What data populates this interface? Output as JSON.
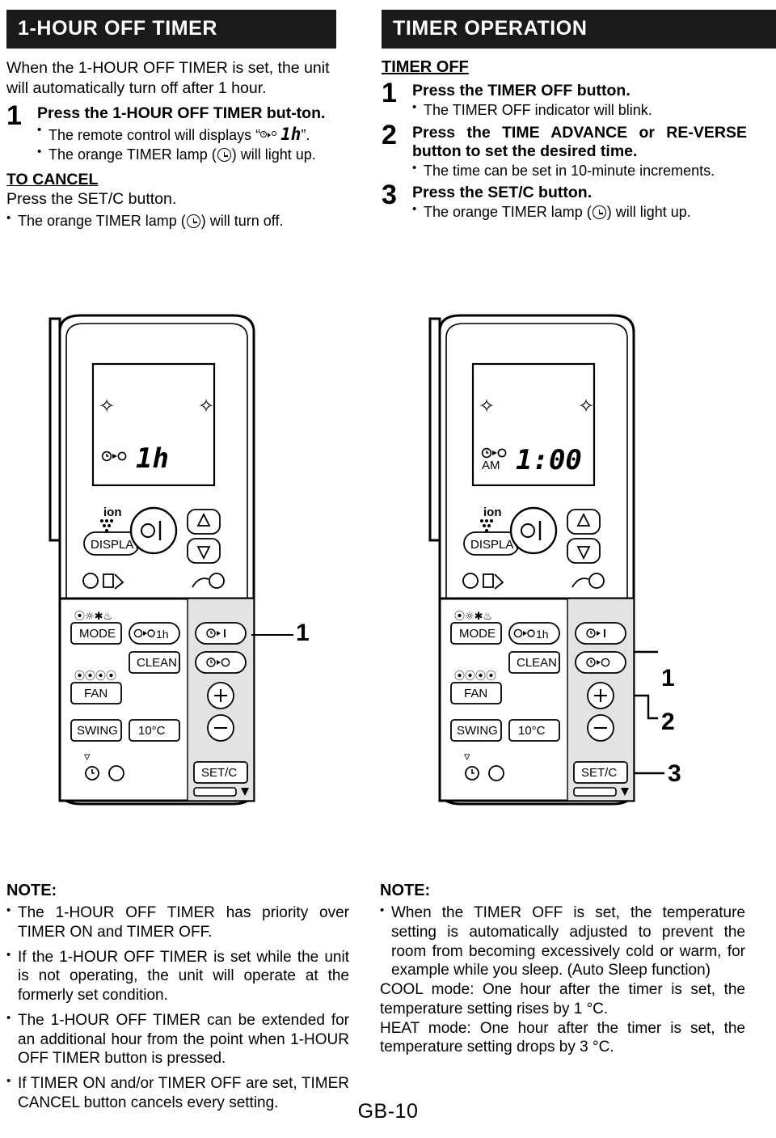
{
  "left": {
    "header": "1-HOUR OFF TIMER",
    "intro": "When the 1-HOUR OFF TIMER is set, the unit will automatically turn off after 1 hour.",
    "step1": {
      "num": "1",
      "title": "Press the 1-HOUR OFF TIMER but-ton.",
      "bullet1_pre": "The remote control will displays “",
      "bullet1_post": "”.",
      "bullet2_pre": "The orange TIMER lamp (",
      "bullet2_post": ") will light up."
    },
    "cancel_title": "TO CANCEL",
    "cancel_line": "Press the SET/C button.",
    "cancel_bullet_pre": "The orange TIMER lamp (",
    "cancel_bullet_post": ") will turn off.",
    "callout": "1",
    "notes": {
      "title": "NOTE:",
      "items": [
        "The 1-HOUR OFF TIMER has priority over TIMER ON and TIMER OFF.",
        "If the 1-HOUR OFF TIMER is set while the unit is not operating, the unit will operate at the formerly set condition.",
        "The 1-HOUR OFF TIMER can be extended for an additional hour from the point when 1-HOUR OFF TIMER button is pressed.",
        "If TIMER ON and/or TIMER OFF are set, TIMER CANCEL button cancels every setting."
      ]
    }
  },
  "right": {
    "header": "TIMER OPERATION",
    "subhead": "TIMER OFF",
    "step1": {
      "num": "1",
      "title": "Press the TIMER OFF button.",
      "bullet": "The TIMER OFF indicator will blink."
    },
    "step2": {
      "num": "2",
      "title": "Press the TIME ADVANCE or RE-VERSE button to set the desired time.",
      "bullet": "The time can be set in 10-minute increments."
    },
    "step3": {
      "num": "3",
      "title": "Press the SET/C button.",
      "bullet_pre": "The orange TIMER lamp (",
      "bullet_post": ") will light up."
    },
    "callouts": [
      "1",
      "2",
      "3"
    ],
    "notes": {
      "title": "NOTE:",
      "bullet": "When the TIMER OFF is set, the temperature setting is automatically adjusted to prevent the room from becoming excessively cold or warm, for example while you sleep. (Auto Sleep function)",
      "line1": "COOL mode: One hour after the timer is set, the temperature setting rises by 1 °C.",
      "line2": "HEAT mode: One hour after the timer is set, the temperature setting drops by 3 °C."
    }
  },
  "remote_left": {
    "display_value": "1h",
    "buttons": {
      "display": "DISPLAY",
      "mode": "MODE",
      "clean": "CLEAN",
      "fan": "FAN",
      "swing": "SWING",
      "tenc": "10°C",
      "setc": "SET/C",
      "onehour": "1h",
      "ion": "ion"
    }
  },
  "remote_right": {
    "display_value": "1:00",
    "display_ampm": "AM",
    "buttons": {
      "display": "DISPLAY",
      "mode": "MODE",
      "clean": "CLEAN",
      "fan": "FAN",
      "swing": "SWING",
      "tenc": "10°C",
      "setc": "SET/C",
      "onehour": "1h",
      "ion": "ion"
    }
  },
  "page_number": "GB-10"
}
